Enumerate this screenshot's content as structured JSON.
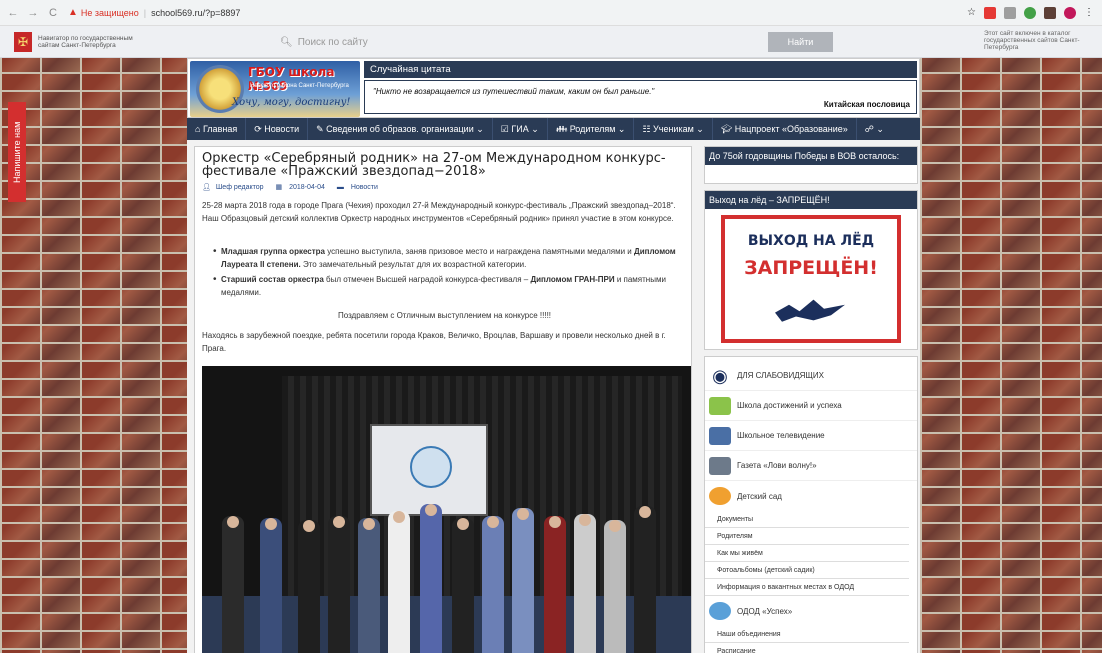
{
  "browser": {
    "security": "Не защищено",
    "url": "school569.ru/?p=8897",
    "back": "←",
    "forward": "→",
    "reload": "C",
    "star": "☆"
  },
  "govbar": {
    "left_text": "Навигатор по государственным сайтам Санкт-Петербурга",
    "search_placeholder": "Поиск по сайту",
    "search_button": "Найти",
    "right_text": "Этот сайт включен в каталог государственных сайтов Санкт-Петербурга"
  },
  "sidetab": "Напишите нам",
  "logo": {
    "name": "ГБОУ школа №569",
    "sub": "Невского района Санкт-Петербурга",
    "motto": "Хочу, могу, достигну!"
  },
  "quote": {
    "title": "Случайная цитата",
    "text": "Никто не возвращается из путешествий таким, каким он был раньше.",
    "author": "Китайская пословица"
  },
  "nav": [
    "Главная",
    "Новости",
    "Сведения об образов. организации ⌄",
    "ГИА ⌄",
    "Родителям ⌄",
    "Ученикам ⌄",
    "Нацпроект «Образование»",
    "⌄"
  ],
  "article": {
    "title": "Оркестр «Серебряный родник» на 27-ом Международном конкурс-фестивале «Пражский звездопад−2018»",
    "author": "Шеф редактор",
    "date": "2018-04-04",
    "category": "Новости",
    "p1": "25-28 марта 2018 года в городе Прага (Чехия) проходил 27-й Международный конкурс-фестиваль „Пражский звездопад–2018“. Наш  Образцовый детский коллектив Оркестр народных инструментов «Серебряный родник» принял участие в этом конкурсе.",
    "b1_bold": "Младшая группа оркестра",
    "b1_a": " успешно выступила,  заняв призовое место и награждена  памятными медалями и ",
    "b1_bold2": "Дипломом  Лауреата  II степени.",
    "b1_b": " Это замечательный результат для их возрастной категории.",
    "b2_bold": "Старший состав оркестра",
    "b2_a": " был отмечен Высшей наградой конкурса-фестиваля – ",
    "b2_bold2": "Дипломом ГРАН-ПРИ",
    "b2_b": " и памятными медалями.",
    "congrats": "Поздравляем с Отличным выступлением на конкурсе !!!!!",
    "p2": "Находясь в зарубежной поездке, ребята посетили города Краков, Величко, Вроцлав, Варшаву и провели несколько дней в г. Прага."
  },
  "sidebar": {
    "w1_title": "До 75ой годовщины Победы в ВОВ осталось:",
    "w2_title": "Выход на лёд – ЗАПРЕЩЁН!",
    "ban_l1": "ВЫХОД НА ЛЁД",
    "ban_l2": "ЗАПРЕЩЁН!",
    "links": [
      {
        "label": "ДЛЯ СЛАБОВИДЯЩИХ",
        "icon": "eye-icon"
      },
      {
        "label": "Школа достижений и успеха",
        "icon": "cup-icon"
      },
      {
        "label": "Школьное телевидение",
        "icon": "tv-icon"
      },
      {
        "label": "Газета «Лови волну!»",
        "icon": "newspaper-icon"
      },
      {
        "label": "Детский сад",
        "icon": "kids-icon"
      }
    ],
    "kinder_sub": [
      "Документы",
      "Родителям",
      "Как мы живём",
      "Фотоальбомы (детский садик)",
      "Информация о вакантных местах в ОДОД"
    ],
    "odod": "ОДОД «Успех»",
    "odod_sub": [
      "Наши объединения",
      "Расписание"
    ]
  },
  "colors": {
    "nav": "#2a3b55",
    "accent_red": "#d32f2f",
    "link": "#2a4d8a"
  }
}
